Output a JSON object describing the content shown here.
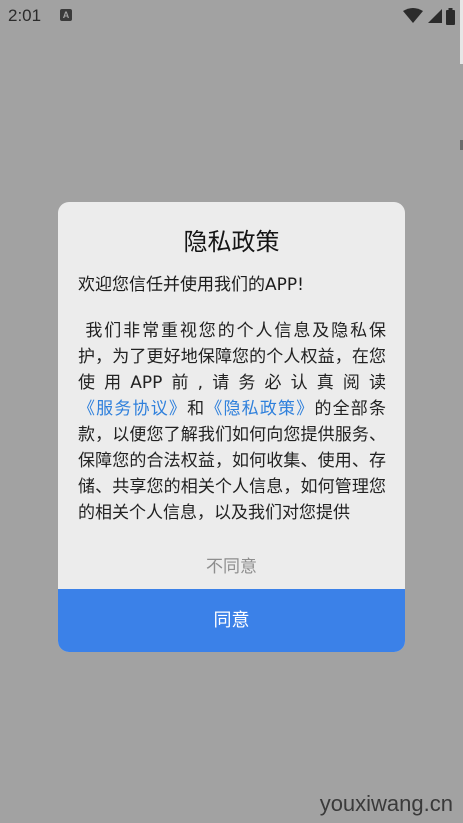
{
  "status_bar": {
    "time": "2:01",
    "notification_glyph": "A",
    "icons": [
      "wifi-icon",
      "signal-icon",
      "battery-icon"
    ]
  },
  "dialog": {
    "title": "隐私政策",
    "welcome": "欢迎您信任并使用我们的APP!",
    "body_intro": "我们非常重视您的个人信息及隐私保护，为了更好地保障您的个人权益，在您使用APP前,请务必认真阅读",
    "link_service": "《服务协议》",
    "connector": "和",
    "link_privacy": "《隐私政策》",
    "body_rest": "的全部条款，以便您了解我们如何向您提供服务、保障您的合法权益，如何收集、使用、存储、共享您的相关个人信息，如何管理您的相关个人信息，以及我们对您提供",
    "disagree_label": "不同意",
    "agree_label": "同意"
  },
  "watermark": "youxiwang.cn",
  "colors": {
    "overlay": "#a2a2a2",
    "dialog_bg": "#ececec",
    "agree_button": "#3b81e8",
    "link": "#2f80dc"
  }
}
